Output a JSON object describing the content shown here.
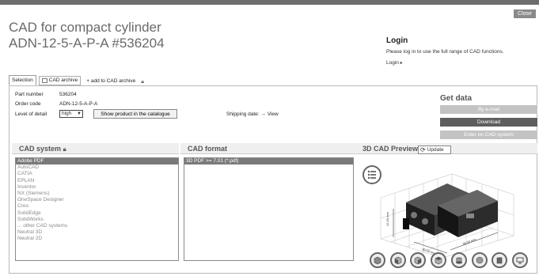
{
  "window": {
    "close_label": "Close"
  },
  "header": {
    "title_line1": "CAD for compact cylinder",
    "title_line2": "ADN-12-5-A-P-A #536204"
  },
  "login": {
    "title": "Login",
    "description": "Please log in to use the full range of CAD functions.",
    "link_label": "Login"
  },
  "tabs": [
    {
      "label": "Selection",
      "active": true
    },
    {
      "label": "CAD archive",
      "active": false
    },
    {
      "label": "add to CAD archive",
      "active": false
    }
  ],
  "product": {
    "part_number_label": "Part number",
    "part_number_value": "536204",
    "order_code_label": "Order code",
    "order_code_value": "ADN-12-5-A-P-A",
    "level_of_detail_label": "Level of detail",
    "level_of_detail_value": "high",
    "show_product_button": "Show product in the catalogue",
    "shipping_label": "Shipping date:",
    "shipping_link": "View"
  },
  "get_data": {
    "title": "Get data",
    "by_email": "By e-mail",
    "download": "Download",
    "enter_cad": "Enter on CAD system"
  },
  "cad_system": {
    "title": "CAD system",
    "items": [
      "Adobe PDF",
      "AutoCAD",
      "CATIA",
      "EPLAN",
      "Inventor",
      "NX (Siemens)",
      "OneSpace Designer",
      "Creo",
      "SolidEdge",
      "SolidWorks",
      "... other CAD systems",
      "Neutral 3D",
      "Neutral 2D"
    ],
    "selected_index": 0
  },
  "cad_format": {
    "title": "CAD format",
    "items": [
      "3D PDF >= 7.01 (*.pdf)"
    ],
    "selected_index": 0
  },
  "preview": {
    "title": "3D CAD Preview",
    "update_label": "Update",
    "view_buttons": [
      "iso-view",
      "front-view",
      "side-view",
      "top-view",
      "bottom-view",
      "back-view",
      "right-view",
      "screen-view"
    ]
  },
  "colors": {
    "accent_dark": "#5e5e5e",
    "disabled": "#c3c3c3",
    "selection": "#7a7a7a"
  }
}
